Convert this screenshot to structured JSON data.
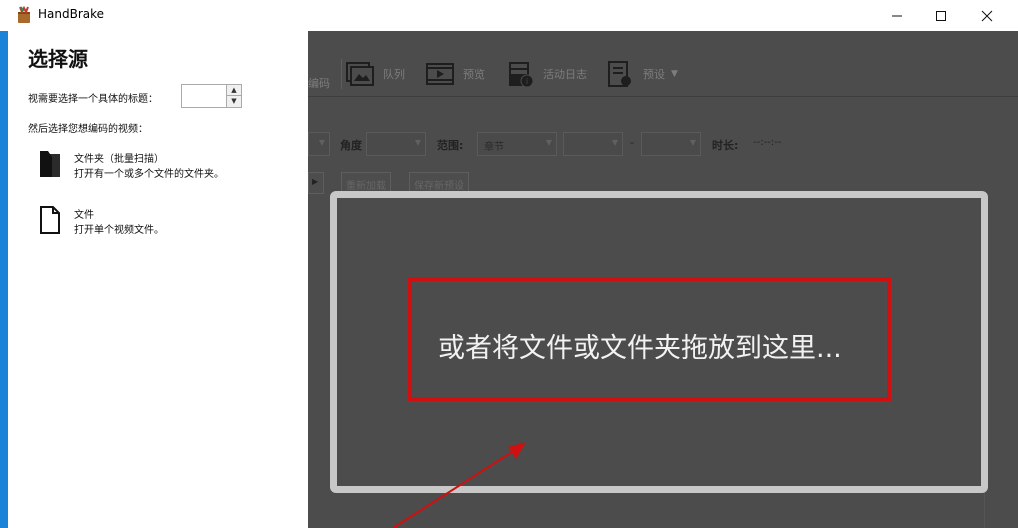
{
  "window": {
    "title": "HandBrake",
    "controls": {
      "minimize": "minimize-icon",
      "maximize": "maximize-icon",
      "close": "close-icon"
    }
  },
  "source_panel": {
    "heading": "选择源",
    "title_prompt": "视需要选择一个具体的标题：",
    "title_spinner_value": "",
    "video_prompt": "然后选择您想编码的视频：",
    "options": [
      {
        "icon": "folder-icon",
        "title": "文件夹（批量扫描）",
        "description": "打开有一个或多个文件的文件夹。"
      },
      {
        "icon": "file-icon",
        "title": "文件",
        "description": "打开单个视频文件。"
      }
    ]
  },
  "toolbar": {
    "encode_label": "编码",
    "queue_label": "队列",
    "preview_label": "预览",
    "activity_label": "活动日志",
    "presets_label": "预设"
  },
  "source_options": {
    "angle_label": "角度",
    "range_label": "范围:",
    "range_value": "章节",
    "dash": "-",
    "duration_label": "时长:",
    "duration_value": "--:--:--"
  },
  "preset_buttons": {
    "reload_label": "重新加载",
    "save_new_label": "保存新预设"
  },
  "drop_zone": {
    "text": "或者将文件或文件夹拖放到这里..."
  },
  "colors": {
    "highlight_red": "#d01010",
    "drop_border": "#c8c8c8",
    "dark_background": "#4c4c4c",
    "accent_blue": "#1a82d8"
  }
}
